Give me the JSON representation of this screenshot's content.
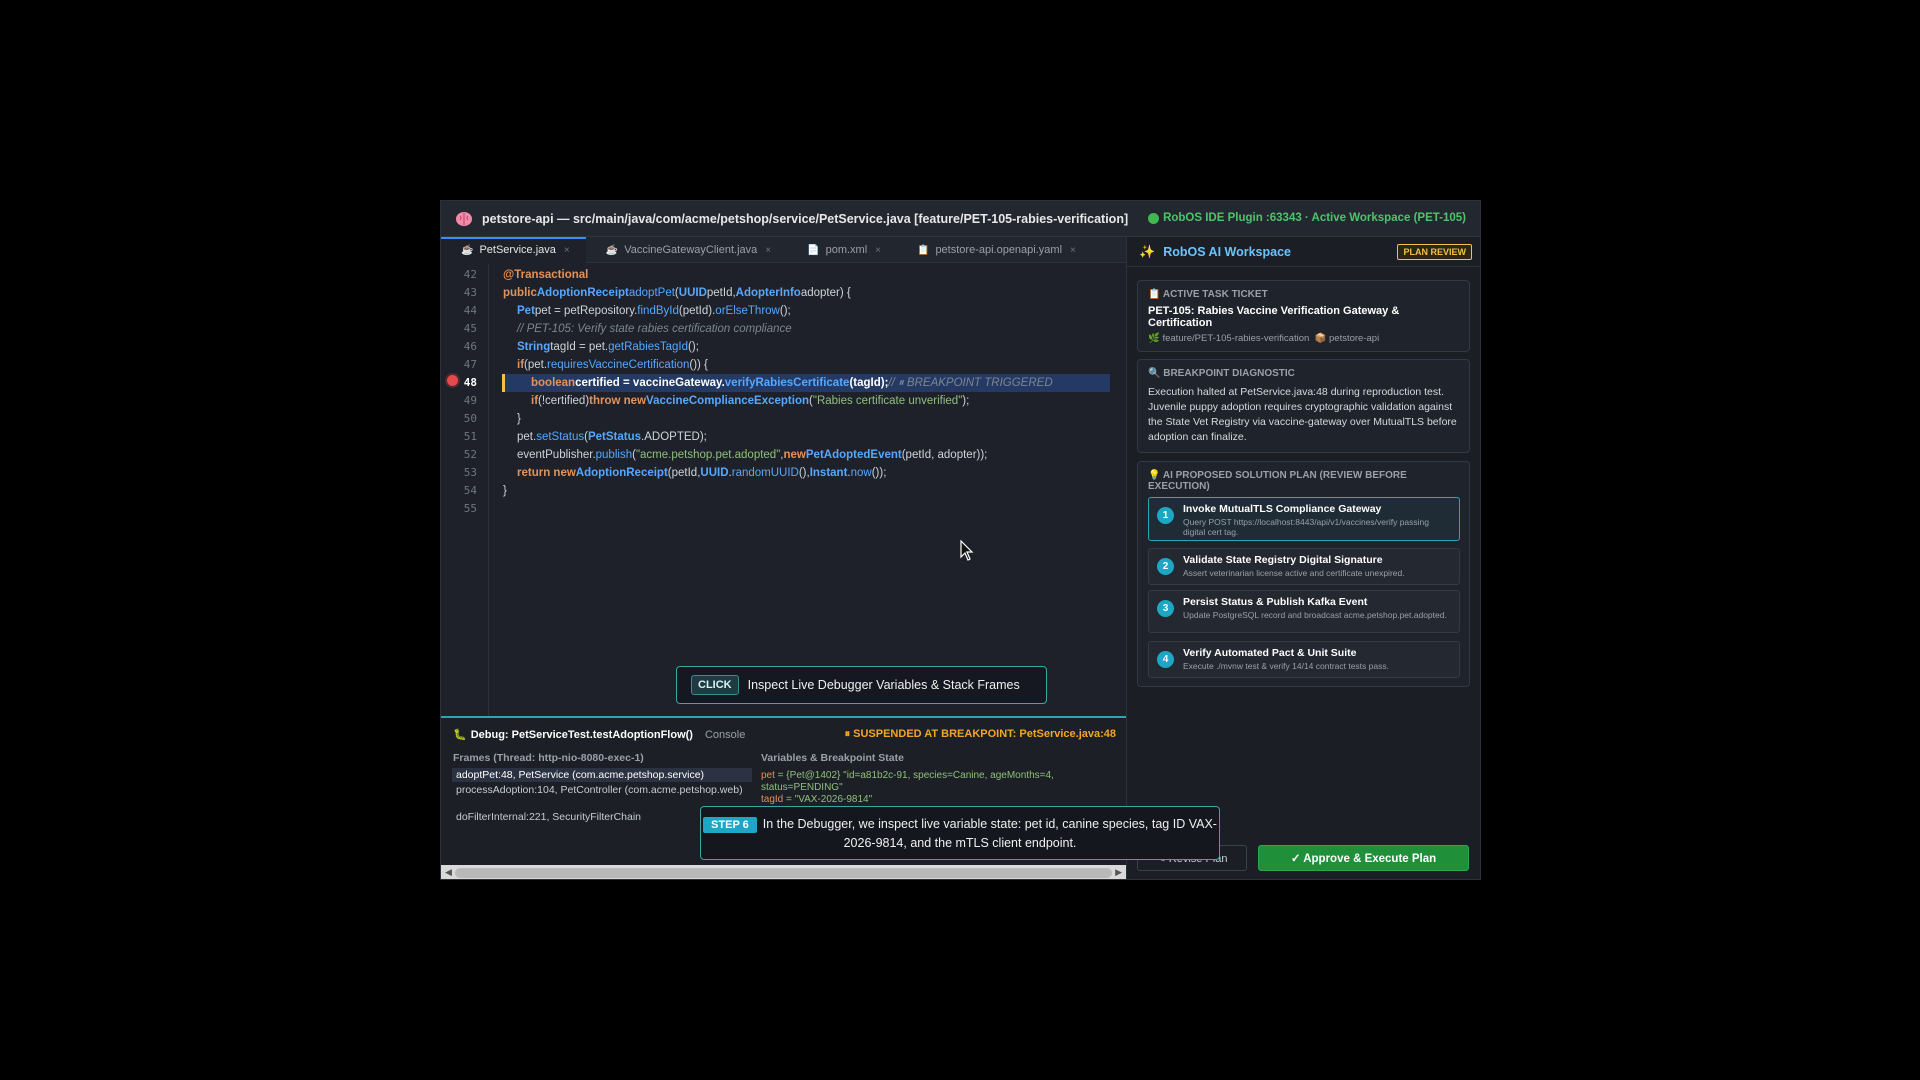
{
  "window": {
    "title": "petstore-api — src/main/java/com/acme/petshop/service/PetService.java [feature/PET-105-rabies-verification]",
    "plugin_status": "RobOS IDE Plugin :63343 · Active Workspace (PET-105)"
  },
  "tabs": [
    {
      "label": "PetService.java"
    },
    {
      "label": "VaccineGatewayClient.java"
    },
    {
      "label": "pom.xml"
    },
    {
      "label": "petstore-api.openapi.yaml"
    }
  ],
  "code": {
    "line_numbers": [
      "42",
      "43",
      "44",
      "45",
      "46",
      "47",
      "48",
      "49",
      "50",
      "51",
      "52",
      "53",
      "54",
      "55"
    ],
    "breakpoint_line": "48",
    "l42": {
      "a": "@Transactional"
    },
    "l43": {
      "a": "public ",
      "b": "AdoptionReceipt ",
      "c": "adoptPet",
      "d": "(",
      "e": "UUID",
      "f": " petId, ",
      "g": "AdopterInfo",
      "h": " adopter) {"
    },
    "l44": {
      "a": "Pet",
      "b": " pet = petRepository.",
      "c": "findById",
      "d": "(petId).",
      "e": "orElseThrow",
      "f": "();"
    },
    "l45": {
      "a": "// PET-105: Verify state rabies certification compliance"
    },
    "l46": {
      "a": "String",
      "b": " tagId = pet.",
      "c": "getRabiesTagId",
      "d": "();"
    },
    "l47": {
      "a": "if",
      "b": " (pet.",
      "c": "requiresVaccineCertification",
      "d": "()) {"
    },
    "l48": {
      "a": "boolean ",
      "b": "certified = vaccineGateway.",
      "c": "verifyRabiesCertificate",
      "d": "(tagId);",
      "e": " // ⏸ BREAKPOINT TRIGGERED"
    },
    "l49": {
      "a": "if",
      "b": " (!certified) ",
      "c": "throw new ",
      "d": "VaccineComplianceException",
      "e": "(",
      "f": "\"Rabies certificate unverified\"",
      "g": ");"
    },
    "l50": {
      "a": "}"
    },
    "l51": {
      "a": "pet.",
      "b": "setStatus",
      "c": "(",
      "d": "PetStatus",
      "e": ".ADOPTED);"
    },
    "l52": {
      "a": "eventPublisher.",
      "b": "publish",
      "c": "(",
      "d": "\"acme.petshop.pet.adopted\"",
      "e": ", ",
      "f": "new ",
      "g": "PetAdoptedEvent",
      "h": "(petId, adopter));"
    },
    "l53": {
      "a": "return new ",
      "b": "AdoptionReceipt",
      "c": "(petId, ",
      "d": "UUID",
      "e": ".",
      "f": "randomUUID",
      "g": "(), ",
      "h": "Instant",
      "i": ".",
      "j": "now",
      "k": "());"
    },
    "l54": {
      "a": "}"
    }
  },
  "click_hint": {
    "badge": "CLICK",
    "text": "Inspect Live Debugger Variables & Stack Frames"
  },
  "debug": {
    "title": "Debug: PetServiceTest.testAdoptionFlow()",
    "console_tab": "Console",
    "suspended": "⏸ SUSPENDED AT BREAKPOINT: PetService.java:48",
    "frames_header": "Frames (Thread: http-nio-8080-exec-1)",
    "frames": [
      "adoptPet:48, PetService (com.acme.petshop.service)",
      "processAdoption:104, PetController (com.acme.petshop.web)",
      "doFilterInternal:221, SecurityFilterChain"
    ],
    "vars_header": "Variables & Breakpoint State",
    "var_pet_name": "pet",
    "var_pet_value": " = {Pet@1402} \"id=a81b2c-91, species=Canine, ageMonths=4, status=PENDING\"",
    "var_tag_name": "tagId",
    "var_tag_value": " = \"VAX-2026-9814\""
  },
  "workspace": {
    "title": "RobOS AI Workspace",
    "badge": "PLAN REVIEW",
    "ticket_label": "📋 ACTIVE TASK TICKET",
    "ticket_title": "PET-105: Rabies Vaccine Verification Gateway & Certification",
    "ticket_branch": "🌿 feature/PET-105-rabies-verification",
    "ticket_repo": "📦 petstore-api",
    "diag_label": "🔍 BREAKPOINT DIAGNOSTIC",
    "diag_body": "Execution halted at PetService.java:48 during reproduction test. Juvenile puppy adoption requires cryptographic validation against the State Vet Registry via vaccine-gateway over MutualTLS before adoption can finalize.",
    "plan_label": "💡 AI PROPOSED SOLUTION PLAN (REVIEW BEFORE EXECUTION)",
    "steps": [
      {
        "num": "1",
        "title": "Invoke MutualTLS Compliance Gateway",
        "desc": "Query POST https://localhost:8443/api/v1/vaccines/verify passing digital cert tag."
      },
      {
        "num": "2",
        "title": "Validate State Registry Digital Signature",
        "desc": "Assert veterinarian license active and certificate unexpired."
      },
      {
        "num": "3",
        "title": "Persist Status & Publish Kafka Event",
        "desc": "Update PostgreSQL record and broadcast acme.petshop.pet.adopted."
      },
      {
        "num": "4",
        "title": "Verify Automated Pact & Unit Suite",
        "desc": "Execute ./mvnw test & verify 14/14 contract tests pass."
      }
    ],
    "revise_label": "✎ Revise Plan",
    "approve_label": "✓ Approve & Execute Plan"
  },
  "caption": {
    "badge": "STEP 6",
    "text": "In the Debugger, we inspect live variable state: pet id, canine species, tag ID VAX-2026-9814, and the mTLS client endpoint."
  }
}
